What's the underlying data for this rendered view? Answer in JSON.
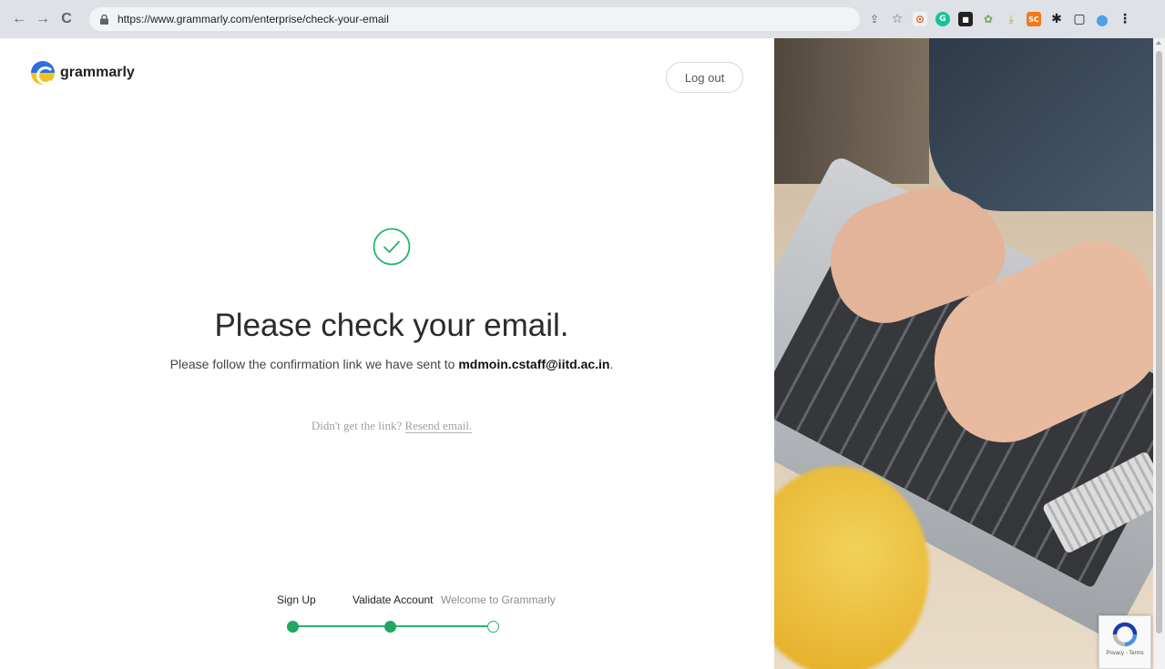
{
  "browser": {
    "url": "https://www.grammarly.com/enterprise/check-your-email",
    "nav": {
      "back_icon": "←",
      "forward_icon": "→",
      "reload_icon": "C"
    },
    "extensions": [
      {
        "name": "share-icon",
        "glyph": "⇪"
      },
      {
        "name": "star-icon",
        "glyph": "☆"
      },
      {
        "name": "camera-extension-icon",
        "glyph": "⊙"
      },
      {
        "name": "grammarly-extension-icon",
        "glyph": "G"
      },
      {
        "name": "black-extension-icon",
        "glyph": "■"
      },
      {
        "name": "colorful-extension-icon",
        "glyph": "✿"
      },
      {
        "name": "download-icon",
        "glyph": "⤓"
      },
      {
        "name": "sc-extension-icon",
        "glyph": "SC"
      },
      {
        "name": "puzzle-icon",
        "glyph": "✱"
      },
      {
        "name": "tab-icon",
        "glyph": "▢"
      },
      {
        "name": "profile-avatar",
        "glyph": "●"
      },
      {
        "name": "more-menu-icon",
        "glyph": "⋮"
      }
    ]
  },
  "header": {
    "logo_text": "grammarly",
    "logout_label": "Log out"
  },
  "main": {
    "headline": "Please check your email.",
    "sub_prefix": "Please follow the confirmation link we have sent to ",
    "email": "mdmoin.cstaff@iitd.ac.in",
    "sub_suffix": ".",
    "resend_prefix": "Didn't get the link? ",
    "resend_link": "Resend email."
  },
  "steps": [
    {
      "label": "Sign Up",
      "state": "done"
    },
    {
      "label": "Validate Account",
      "state": "done"
    },
    {
      "label": "Welcome to Grammarly",
      "state": "todo"
    }
  ],
  "recaptcha": {
    "text": "Privacy - Terms"
  },
  "colors": {
    "accent": "#1fa75f",
    "brand_blue": "#2b6fe0",
    "brand_yellow": "#f4c022"
  }
}
